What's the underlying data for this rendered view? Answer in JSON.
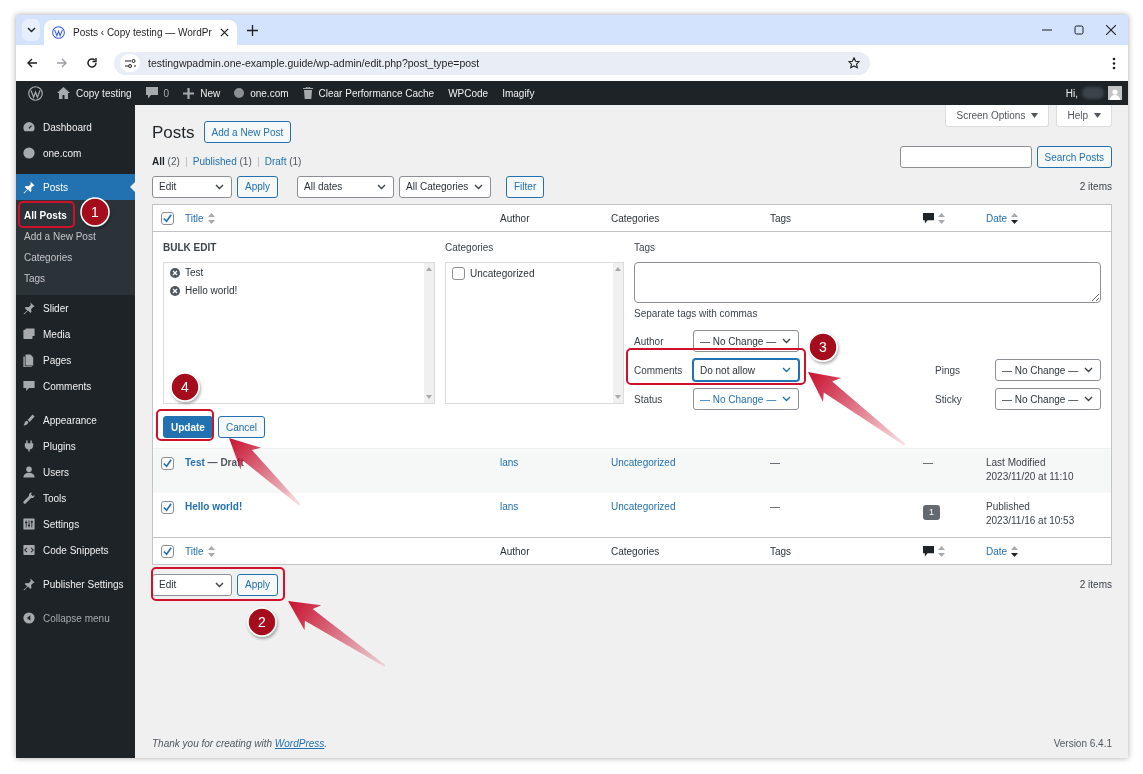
{
  "browser": {
    "tab_title": "Posts ‹ Copy testing — WordPr",
    "url": "testingwpadmin.one-example.guide/wp-admin/edit.php?post_type=post"
  },
  "admin_bar": {
    "items": [
      {
        "kind": "logo"
      },
      {
        "kind": "home",
        "label": "Copy testing"
      },
      {
        "kind": "comments",
        "label": "0"
      },
      {
        "kind": "new",
        "label": "New"
      },
      {
        "kind": "dot",
        "label": "one.com"
      },
      {
        "kind": "trash",
        "label": "Clear Performance Cache"
      },
      {
        "kind": "text",
        "label": "WPCode"
      },
      {
        "kind": "text",
        "label": "Imagify"
      }
    ],
    "greeting": "Hi,"
  },
  "sidebar": {
    "groups": [
      {
        "items": [
          {
            "label": "Dashboard",
            "selected": false
          },
          {
            "label": "one.com",
            "selected": false
          }
        ]
      },
      {
        "items": [
          {
            "label": "Posts",
            "selected": true,
            "children": [
              {
                "label": "All Posts",
                "selected": true
              },
              {
                "label": "Add a New Post",
                "selected": false
              },
              {
                "label": "Categories",
                "selected": false
              },
              {
                "label": "Tags",
                "selected": false
              }
            ]
          },
          {
            "label": "Slider",
            "selected": false
          },
          {
            "label": "Media",
            "selected": false
          },
          {
            "label": "Pages",
            "selected": false
          },
          {
            "label": "Comments",
            "selected": false
          }
        ]
      },
      {
        "items": [
          {
            "label": "Appearance",
            "selected": false
          },
          {
            "label": "Plugins",
            "selected": false
          },
          {
            "label": "Users",
            "selected": false
          },
          {
            "label": "Tools",
            "selected": false
          },
          {
            "label": "Settings",
            "selected": false
          },
          {
            "label": "Code Snippets",
            "selected": false
          }
        ]
      },
      {
        "items": [
          {
            "label": "Publisher Settings",
            "selected": false
          }
        ]
      }
    ],
    "collapse": "Collapse menu"
  },
  "page": {
    "title": "Posts",
    "add_new": "Add a New Post",
    "screen_options": "Screen Options",
    "help": "Help",
    "views": [
      {
        "label": "All",
        "count": "(2)",
        "selected": true
      },
      {
        "label": "Published",
        "count": "(1)",
        "selected": false
      },
      {
        "label": "Draft",
        "count": "(1)",
        "selected": false
      }
    ],
    "search_button": "Search Posts",
    "top_nav": {
      "bulk_action": "Edit",
      "apply": "Apply",
      "date_filter": "All dates",
      "category_filter": "All Categories",
      "filter": "Filter",
      "count": "2 items"
    },
    "columns": [
      {
        "kind": "check",
        "checked": true
      },
      {
        "kind": "sortable",
        "label": "Title",
        "sorted": false
      },
      {
        "kind": "plain",
        "label": "Author"
      },
      {
        "kind": "plain",
        "label": "Categories"
      },
      {
        "kind": "plain",
        "label": "Tags"
      },
      {
        "kind": "comments",
        "sorted": false
      },
      {
        "kind": "sortable",
        "label": "Date",
        "sorted": true
      }
    ],
    "bulk_edit": {
      "heading": "BULK EDIT",
      "titles": [
        "Test",
        "Hello world!"
      ],
      "categories_label": "Categories",
      "categories": [
        {
          "label": "Uncategorized",
          "checked": false
        }
      ],
      "tags_label": "Tags",
      "tags_hint": "Separate tags with commas",
      "fields": [
        {
          "label": "Author",
          "value": "— No Change —",
          "focused": false,
          "hovered": false
        },
        {
          "label": "Comments",
          "value": "Do not allow",
          "focused": true,
          "hovered": false
        },
        {
          "label": "Status",
          "value": "— No Change —",
          "focused": false,
          "hovered": true
        }
      ],
      "side_fields": [
        {
          "label": "Pings",
          "value": "— No Change —",
          "focused": false,
          "hovered": false
        },
        {
          "label": "Sticky",
          "value": "— No Change —",
          "focused": false,
          "hovered": false
        }
      ],
      "update": "Update",
      "cancel": "Cancel"
    },
    "rows": [
      {
        "checked": true,
        "title": "Test",
        "state": "— Draft",
        "author": "lans",
        "categories": "Uncategorized",
        "tags": "—",
        "comments": {
          "kind": "none",
          "text": "—"
        },
        "date_status": "Last Modified",
        "date": "2023/11/20 at 11:10"
      },
      {
        "checked": true,
        "title": "Hello world!",
        "author": "lans",
        "categories": "Uncategorized",
        "tags": "—",
        "comments": {
          "kind": "bubble",
          "text": "1"
        },
        "date_status": "Published",
        "date": "2023/11/16 at 10:53"
      }
    ],
    "footer_columns": [
      {
        "kind": "check",
        "checked": true
      },
      {
        "kind": "sortable",
        "label": "Title",
        "sorted": false
      },
      {
        "kind": "plain",
        "label": "Author"
      },
      {
        "kind": "plain",
        "label": "Categories"
      },
      {
        "kind": "plain",
        "label": "Tags"
      },
      {
        "kind": "comments",
        "sorted": false
      },
      {
        "kind": "sortable",
        "label": "Date",
        "sorted": true
      }
    ],
    "bottom_nav": {
      "bulk_action": "Edit",
      "apply": "Apply",
      "count": "2 items"
    },
    "footer": {
      "thanks_before": "Thank you for creating with ",
      "thanks_link": "WordPress",
      "thanks_after": ".",
      "version": "Version 6.4.1"
    }
  },
  "callouts": [
    {
      "number": "1"
    },
    {
      "number": "2"
    },
    {
      "number": "3"
    },
    {
      "number": "4"
    }
  ]
}
